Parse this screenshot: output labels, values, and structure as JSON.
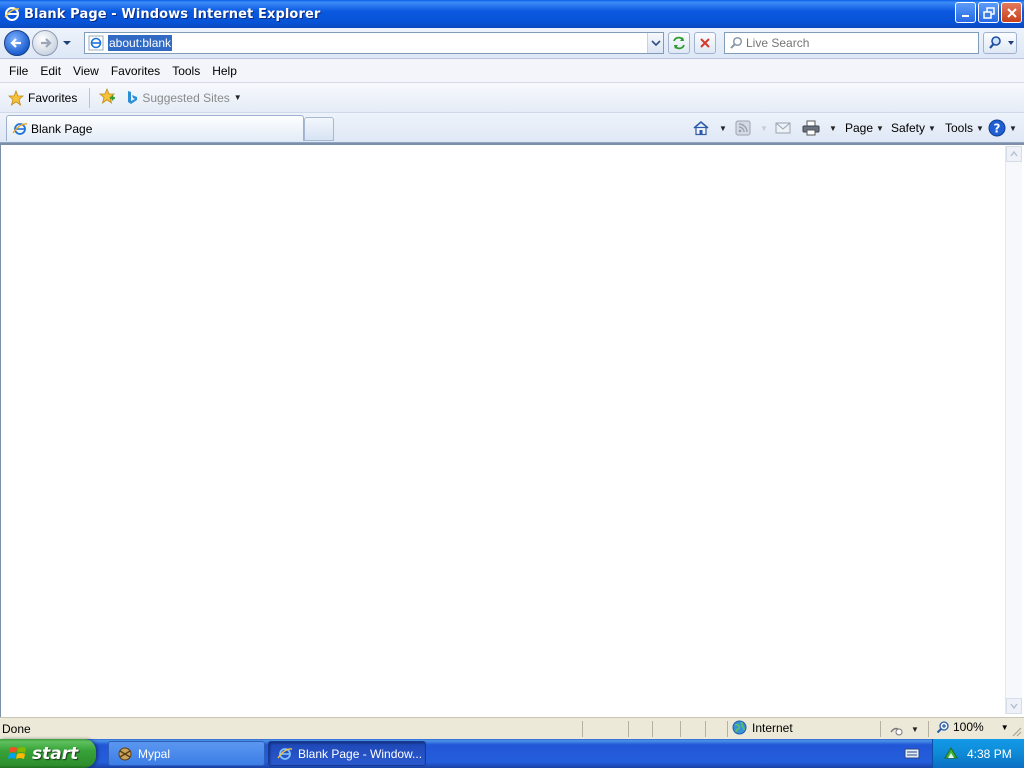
{
  "window": {
    "title": "Blank Page - Windows Internet Explorer"
  },
  "navigation": {
    "address": "about:blank",
    "search_placeholder": "Live Search"
  },
  "menu": [
    "File",
    "Edit",
    "View",
    "Favorites",
    "Tools",
    "Help"
  ],
  "favorites_bar": {
    "favorites_label": "Favorites",
    "suggested_sites_label": "Suggested Sites"
  },
  "tabs": [
    {
      "label": "Blank Page"
    }
  ],
  "command_bar": {
    "page_label": "Page",
    "safety_label": "Safety",
    "tools_label": "Tools"
  },
  "status_bar": {
    "status": "Done",
    "zone": "Internet",
    "zoom": "100%"
  },
  "taskbar": {
    "start_label": "start",
    "tasks": [
      {
        "label": "Mypal"
      },
      {
        "label": "Blank Page - Window..."
      }
    ],
    "clock": "4:38 PM"
  },
  "colors": {
    "titlebar_blue": "#0753d6",
    "selection_blue": "#316ac5",
    "start_green": "#38a238",
    "tray_blue": "#0e8ad6"
  }
}
